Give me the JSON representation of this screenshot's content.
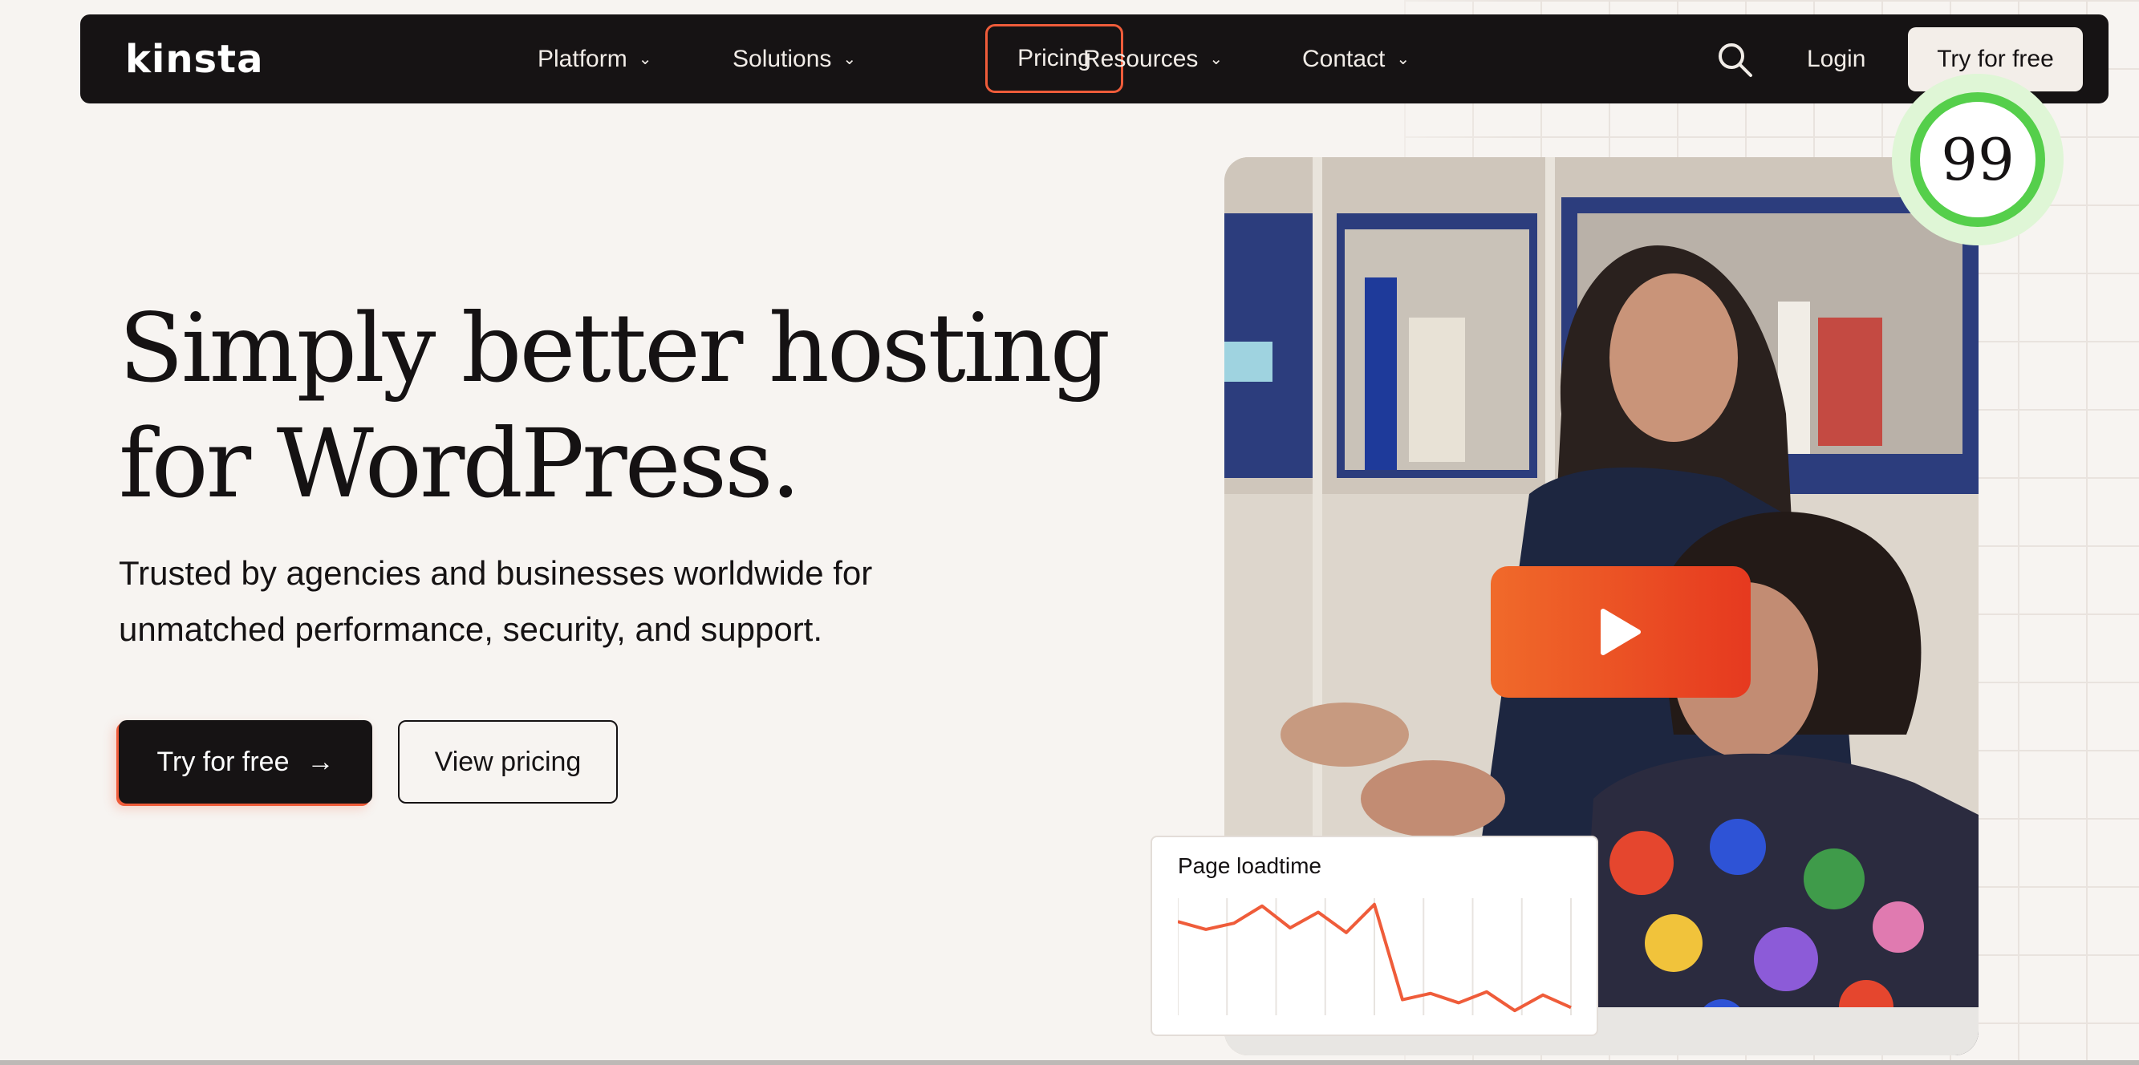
{
  "nav": {
    "logo": "kinsta",
    "items": [
      {
        "label": "Platform",
        "chevron": "⌄"
      },
      {
        "label": "Solutions",
        "chevron": "⌄"
      },
      {
        "label": "Pricing"
      },
      {
        "label": "Resources",
        "chevron": "⌄"
      },
      {
        "label": "Contact",
        "chevron": "⌄"
      }
    ],
    "login": "Login",
    "cta": "Try for free"
  },
  "hero": {
    "title_line1": "Simply better hosting",
    "title_line2": "for WordPress.",
    "subtitle_line1": "Trusted by agencies and businesses worldwide for",
    "subtitle_line2": "unmatched performance, security, and support.",
    "primary_button": "Try for free",
    "primary_arrow": "→",
    "secondary_button": "View pricing"
  },
  "score_badge": {
    "value": "99"
  },
  "loadtime_card": {
    "title": "Page loadtime"
  },
  "colors": {
    "accent": "#ef5c3a",
    "nav_bg": "#161314",
    "score_green": "#55cf4b",
    "play_gradient_start": "#f06a2a",
    "play_gradient_end": "#e6391f"
  },
  "chart_data": {
    "type": "line",
    "title": "Page loadtime",
    "xlabel": "",
    "ylabel": "",
    "grid": "vertical lines",
    "x": [
      0,
      1,
      2,
      3,
      4,
      5,
      6,
      7,
      8,
      9,
      10,
      11,
      12,
      13,
      14,
      15,
      16
    ],
    "values": [
      60,
      55,
      59,
      70,
      56,
      66,
      53,
      71,
      10,
      14,
      8,
      15,
      3,
      13,
      5
    ]
  }
}
